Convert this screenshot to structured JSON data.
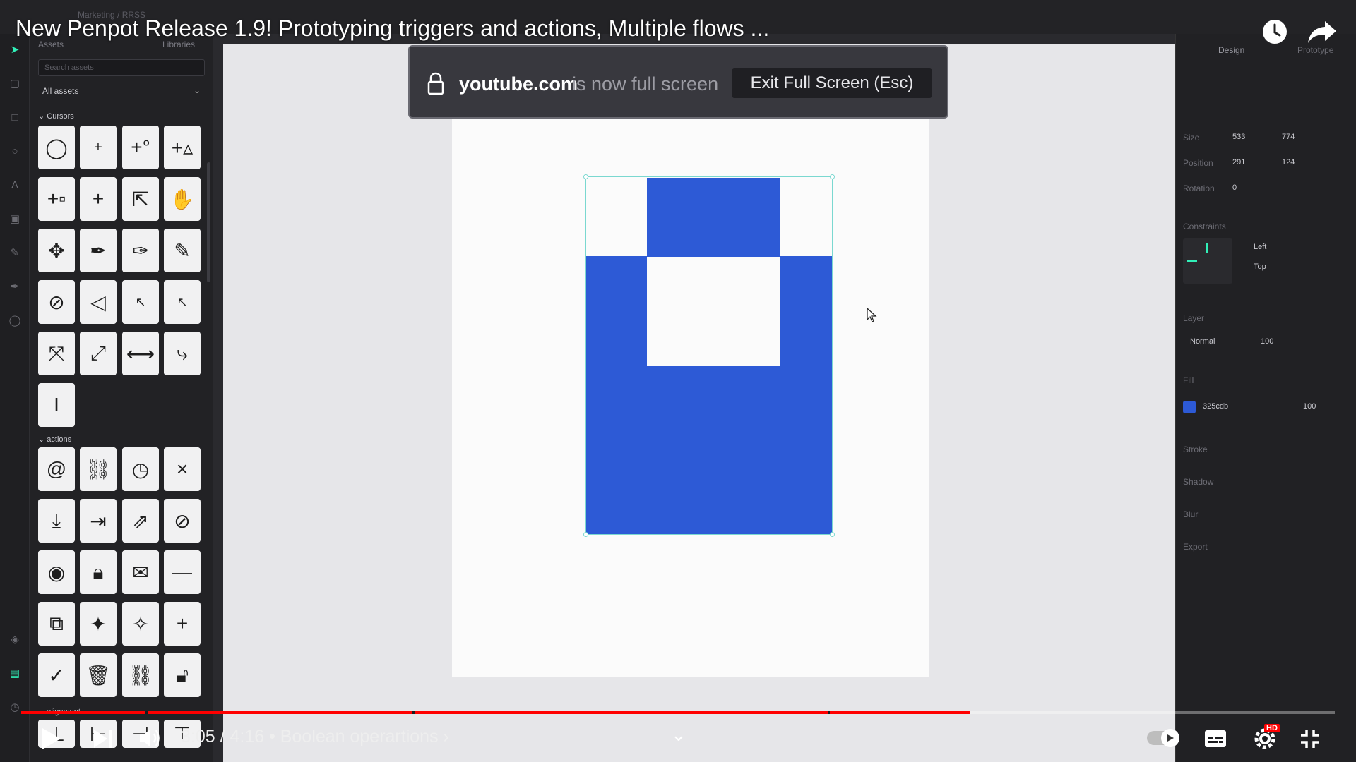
{
  "video": {
    "title": "New Penpot Release 1.9! Prototyping triggers and actions, Multiple flows ...",
    "current_time": "3:05",
    "duration": "4:16",
    "time_display": "3:05 / 4:16",
    "chapter": "Boolean operartions",
    "chapter_display": " • Boolean operartions ›",
    "progress_fraction": 0.722,
    "hd_badge": "HD",
    "accent": "#ff0000"
  },
  "fullscreen_toast": {
    "domain": "youtube.com",
    "message": "is now full screen",
    "exit_label": "Exit Full Screen (Esc)"
  },
  "penpot": {
    "breadcrumb": "Marketing / RRSS",
    "assets_panel": {
      "tab_assets": "Assets",
      "tab_libraries": "Libraries",
      "search_placeholder": "Search assets",
      "filter": "All assets",
      "section_cursors": "Cursors",
      "section_actions": "actions",
      "section_alignment": "alignment"
    },
    "design_panel": {
      "tab_design": "Design",
      "tab_prototype": "Prototype",
      "size_label": "Size",
      "size_w": "533",
      "size_h": "774",
      "position_label": "Position",
      "pos_x": "291",
      "pos_y": "124",
      "rotation_label": "Rotation",
      "rotation": "0",
      "constraints_label": "Constraints",
      "constraint_h": "Left",
      "constraint_v": "Top",
      "layer_label": "Layer",
      "blend": "Normal",
      "layer_opacity": "100",
      "fill_label": "Fill",
      "fill_hex": "325cdb",
      "fill_opacity": "100",
      "stroke_label": "Stroke",
      "shadow_label": "Shadow",
      "blur_label": "Blur",
      "export_label": "Export"
    },
    "fill_color": "#2d5ad6"
  }
}
